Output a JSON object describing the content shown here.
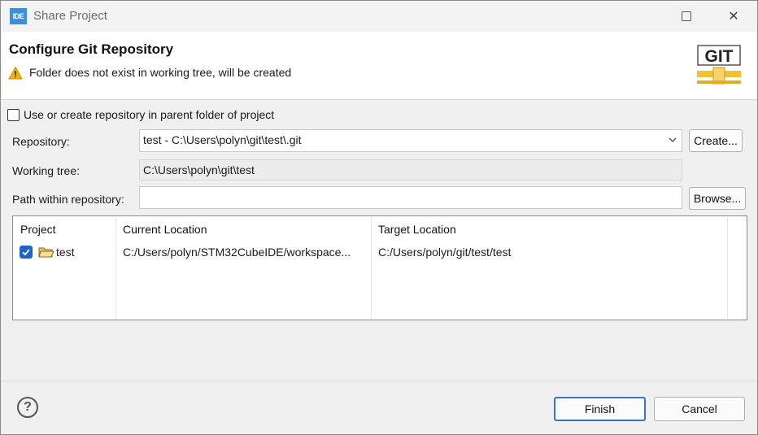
{
  "window": {
    "app_icon_text": "IDE",
    "title": "Share Project",
    "maximize_glyph": "□",
    "close_glyph": "✕"
  },
  "header": {
    "title": "Configure Git Repository",
    "message": "Folder  does not exist in working tree, will be created",
    "logo_text": "GIT",
    "warning_icon": "warning-triangle-icon"
  },
  "options": {
    "use_parent_label": "Use or create repository in parent folder of project",
    "use_parent_checked": false
  },
  "form": {
    "repository_label": "Repository:",
    "repository_value": "test - C:\\Users\\polyn\\git\\test\\.git",
    "create_button": "Create...",
    "working_tree_label": "Working tree:",
    "working_tree_value": "C:\\Users\\polyn\\git\\test",
    "path_label": "Path within repository:",
    "path_value": "",
    "browse_button": "Browse..."
  },
  "table": {
    "columns": [
      "Project",
      "Current Location",
      "Target Location"
    ],
    "rows": [
      {
        "checked": true,
        "project": "test",
        "current_location": "C:/Users/polyn/STM32CubeIDE/workspace...",
        "target_location": "C:/Users/polyn/git/test/test"
      }
    ]
  },
  "footer": {
    "help_glyph": "?",
    "finish_button": "Finish",
    "cancel_button": "Cancel"
  },
  "colors": {
    "accent": "#3a73c8",
    "checkbox_checked": "#1f64c8",
    "app_icon": "#3d8edb",
    "warning": "#f2b705"
  }
}
